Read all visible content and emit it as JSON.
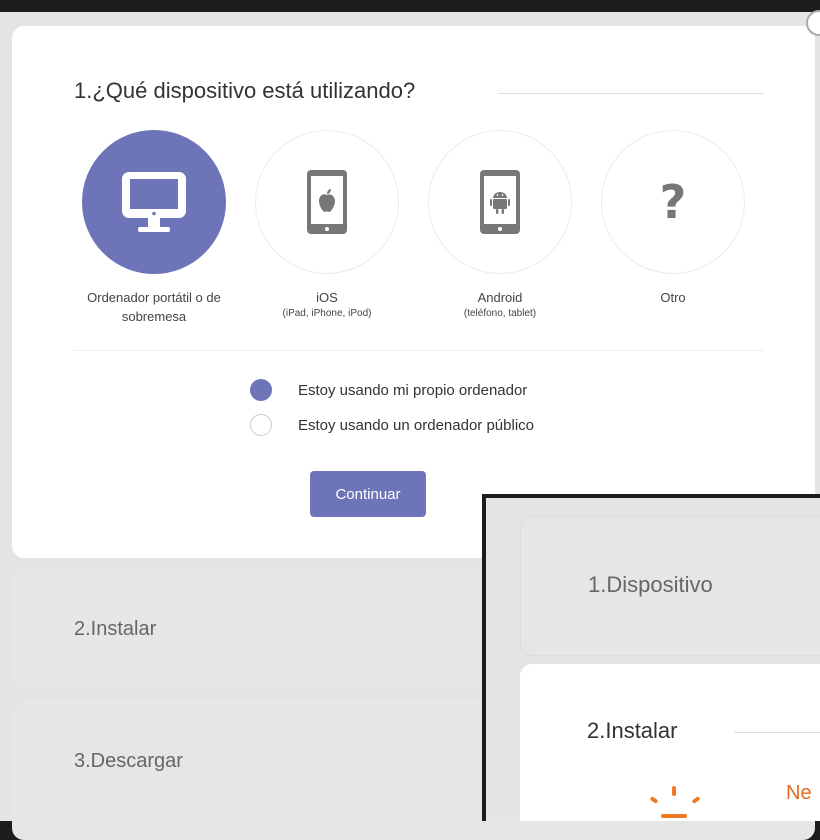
{
  "step1": {
    "title": "1.¿Qué dispositivo está utilizando?",
    "devices": [
      {
        "label": "Ordenador portátil o de sobremesa",
        "sub": "",
        "icon": "desktop-monitor-icon",
        "selected": true
      },
      {
        "label": "iOS",
        "sub": "(iPad, iPhone, iPod)",
        "icon": "ios-tablet-icon",
        "selected": false
      },
      {
        "label": "Android",
        "sub": "(teléfono, tablet)",
        "icon": "android-tablet-icon",
        "selected": false
      },
      {
        "label": "Otro",
        "sub": "",
        "icon": "question-mark-icon",
        "selected": false
      }
    ],
    "options": [
      {
        "label": "Estoy usando mi propio ordenador",
        "checked": true
      },
      {
        "label": "Estoy usando un ordenador público",
        "checked": false
      }
    ],
    "continue_label": "Continuar"
  },
  "step2": {
    "title": "2.Instalar"
  },
  "step3": {
    "title": "3.Descargar"
  },
  "overlay": {
    "step1_title": "1.Dispositivo",
    "step2_title": "2.Instalar",
    "next_text": "Ne"
  },
  "colors": {
    "accent": "#6e74b8",
    "sun_orange": "#f07a24"
  }
}
